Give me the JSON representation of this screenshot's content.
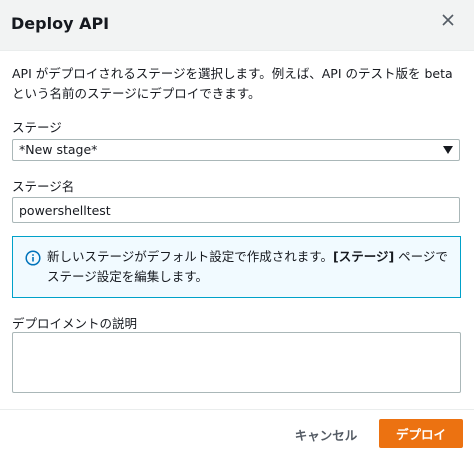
{
  "dialog": {
    "title": "Deploy API",
    "description": "API がデプロイされるステージを選択します。例えば、API のテスト版を beta という名前のステージにデプロイできます。"
  },
  "stage": {
    "label": "ステージ",
    "selected": "*New stage*"
  },
  "stage_name": {
    "label": "ステージ名",
    "value": "powershelltest"
  },
  "info": {
    "text_before": "新しいステージがデフォルト設定で作成されます。",
    "text_bold": "[ステージ]",
    "text_after": " ページでステージ設定を編集します。"
  },
  "deployment_description": {
    "label": "デプロイメントの説明",
    "value": ""
  },
  "footer": {
    "cancel_label": "キャンセル",
    "deploy_label": "デプロイ"
  },
  "colors": {
    "primary_button": "#ec7211",
    "info_border": "#00a1c9",
    "info_background": "#f1faff",
    "header_background": "#f2f3f3"
  },
  "icons": {
    "close": "close-icon",
    "info": "info-icon",
    "caret": "caret-down-icon"
  }
}
